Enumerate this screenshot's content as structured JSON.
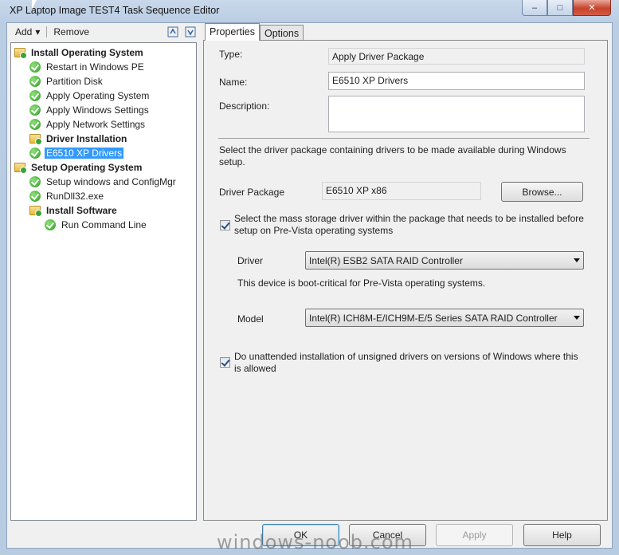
{
  "window": {
    "title": "XP Laptop Image TEST4 Task Sequence Editor",
    "minimize_label": "–",
    "maximize_label": "□",
    "close_label": "✕"
  },
  "toolbar": {
    "add_label": "Add",
    "add_arrow": "▾",
    "remove_label": "Remove"
  },
  "tree": {
    "items": [
      {
        "label": "Install Operating System",
        "icon": "folder-icon",
        "level": 0,
        "group": true
      },
      {
        "label": "Restart in Windows PE",
        "icon": "check-icon",
        "level": 1
      },
      {
        "label": "Partition Disk",
        "icon": "check-icon",
        "level": 1
      },
      {
        "label": "Apply Operating System",
        "icon": "check-icon",
        "level": 1
      },
      {
        "label": "Apply Windows Settings",
        "icon": "check-icon",
        "level": 1
      },
      {
        "label": "Apply Network Settings",
        "icon": "check-icon",
        "level": 1
      },
      {
        "label": "Driver Installation",
        "icon": "folder-icon",
        "level": 1,
        "group": true
      },
      {
        "label": "E6510 XP Drivers",
        "icon": "check-icon",
        "level": 1,
        "selected": true
      },
      {
        "label": "Setup Operating System",
        "icon": "folder-icon",
        "level": 0,
        "group": true
      },
      {
        "label": "Setup windows and ConfigMgr",
        "icon": "check-icon",
        "level": 1
      },
      {
        "label": "RunDll32.exe",
        "icon": "check-icon",
        "level": 1
      },
      {
        "label": "Install Software",
        "icon": "folder-icon",
        "level": 1,
        "group": true
      },
      {
        "label": "Run Command Line",
        "icon": "check-icon",
        "level": 2
      }
    ]
  },
  "tabs": {
    "properties": "Properties",
    "options": "Options"
  },
  "properties": {
    "type_label": "Type:",
    "type_value": "Apply Driver Package",
    "name_label": "Name:",
    "name_value": "E6510 XP Drivers",
    "description_label": "Description:",
    "description_value": "",
    "package_hint": "Select the driver package containing drivers to be made available during Windows setup.",
    "driver_package_label": "Driver Package",
    "driver_package_value": "E6510 XP x86",
    "browse_label": "Browse...",
    "mass_storage_text": "Select the mass storage driver within the package that needs to be installed before setup on Pre-Vista operating systems",
    "mass_storage_checked": true,
    "driver_label": "Driver",
    "driver_value": "Intel(R) ESB2 SATA RAID Controller",
    "boot_critical_text": "This device is boot-critical for Pre-Vista operating systems.",
    "model_label": "Model",
    "model_value": "Intel(R) ICH8M-E/ICH9M-E/5 Series SATA RAID Controller",
    "unsigned_text": "Do unattended installation of unsigned drivers on versions of Windows where this is allowed",
    "unsigned_checked": true
  },
  "buttons": {
    "ok": "OK",
    "cancel": "Cancel",
    "apply": "Apply",
    "help": "Help"
  },
  "watermark": "windows-noob.com",
  "colors": {
    "selection": "#3399ff",
    "title_gradient_top": "#c9d8ea",
    "close_button": "#c7422b"
  }
}
